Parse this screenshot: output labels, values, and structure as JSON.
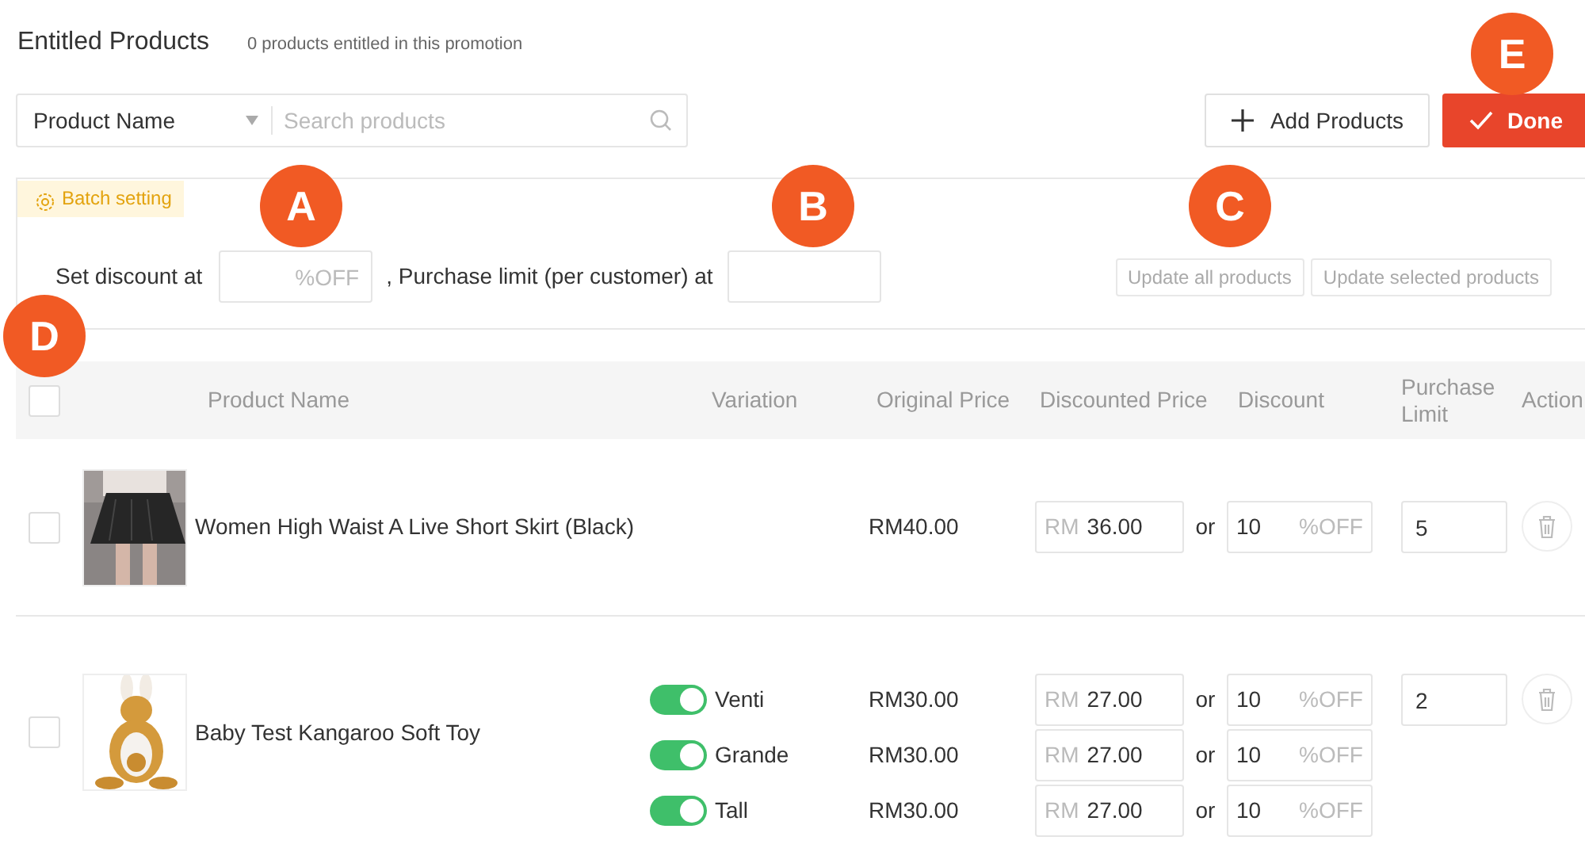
{
  "header": {
    "title": "Entitled Products",
    "subtitle": "0 products entitled in this promotion"
  },
  "search": {
    "filter": "Product Name",
    "placeholder": "Search products"
  },
  "buttons": [
    {
      "kind": "add",
      "label": "Add Products"
    },
    {
      "kind": "done",
      "label": "Done"
    }
  ],
  "batch": {
    "tag": "Batch setting",
    "discount_label": "Set discount at",
    "discount_placeholder": "%OFF",
    "limit_label": ", Purchase limit (per customer) at",
    "actions": [
      "Update all products",
      "Update selected products"
    ]
  },
  "table": {
    "select_all": {
      "checked": false
    },
    "columns": [
      "Product Name",
      "Variation",
      "Original Price",
      "Discounted Price",
      "Discount",
      "Purchase Limit",
      "Action"
    ],
    "rows": [
      {
        "checked": false,
        "image": {
          "kind": "picture"
        },
        "name": "Women High Waist A Live Short Skirt (Black)",
        "purchase_limit": "5",
        "prices": [
          {
            "original_price": "RM40.00",
            "currency": "RM",
            "discounted_price": "36.00",
            "connector": "or",
            "discount": "10",
            "discount_suffix": "%OFF"
          }
        ]
      },
      {
        "checked": false,
        "image": {
          "kind": "picture"
        },
        "name": "Baby Test Kangaroo Soft Toy",
        "purchase_limit": "2",
        "prices": [
          {
            "variation": "Venti",
            "on": true,
            "original_price": "RM30.00",
            "currency": "RM",
            "discounted_price": "27.00",
            "connector": "or",
            "discount": "10",
            "discount_suffix": "%OFF"
          },
          {
            "variation": "Grande",
            "on": true,
            "original_price": "RM30.00",
            "currency": "RM",
            "discounted_price": "27.00",
            "connector": "or",
            "discount": "10",
            "discount_suffix": "%OFF"
          },
          {
            "variation": "Tall",
            "on": true,
            "original_price": "RM30.00",
            "currency": "RM",
            "discounted_price": "27.00",
            "connector": "or",
            "discount": "10",
            "discount_suffix": "%OFF"
          }
        ]
      }
    ]
  },
  "markers": [
    "A",
    "B",
    "C",
    "D",
    "E"
  ]
}
